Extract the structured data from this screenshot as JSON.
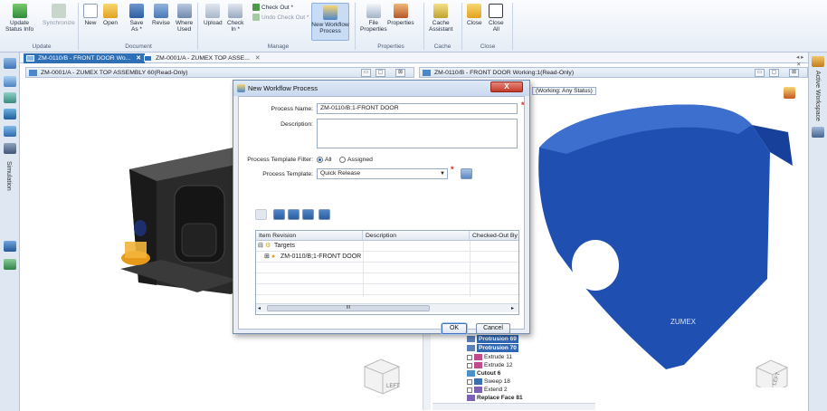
{
  "ribbon": {
    "update_status_info": "Update\nStatus Info",
    "synchronize": "Synchronize",
    "new": "New",
    "open": "Open",
    "save_as": "Save\nAs *",
    "revise": "Revise",
    "where_used": "Where\nUsed",
    "upload": "Upload",
    "check_in": "Check\nIn *",
    "check_out": "Check Out *",
    "undo_check_out": "Undo Check Out *",
    "new_workflow_process": "New Workflow\nProcess",
    "file_properties": "File\nProperties",
    "properties": "Properties",
    "cache_assistant": "Cache\nAssistant",
    "close": "Close",
    "close_all": "Close\nAll",
    "groups": {
      "update": "Update",
      "document": "Document",
      "manage": "Manage",
      "properties": "Properties",
      "cache": "Cache",
      "close": "Close"
    }
  },
  "tabs": [
    {
      "label": "ZM-0110/B - FRONT DOOR Wo..."
    },
    {
      "label": "ZM-0001/A - ZUMEX TOP ASSE..."
    }
  ],
  "left_pane_title": "ZM-0001/A - ZUMEX TOP ASSEMBLY 60(Read-Only)",
  "right_pane_title": "ZM-0110/B - FRONT DOOR Working:1(Read-Only)",
  "right_pane_subtitle": "(Working: Any Status)",
  "left_toolbar": {
    "simulation": "Simulation"
  },
  "right_toolbar": {
    "active_workspace": "Active Workspace"
  },
  "dialog": {
    "title": "New Workflow Process",
    "close_label": "X",
    "process_name_label": "Process Name:",
    "process_name_value": "ZM-0110/B;1-FRONT DOOR",
    "description_label": "Description:",
    "description_value": "",
    "filter_label": "Process Template Filter:",
    "filter_all": "All",
    "filter_assigned": "Assigned",
    "template_label": "Process Template:",
    "template_value": "Quick Release",
    "grid": {
      "columns": [
        "Item Revision",
        "Description",
        "Checked-Out By"
      ],
      "rows": [
        {
          "label": "Targets",
          "description": "",
          "checked_out_by": ""
        },
        {
          "label": "ZM-0110/B;1-FRONT DOOR",
          "description": "",
          "checked_out_by": ""
        }
      ],
      "scroll_thumb": "III"
    },
    "ok_label": "OK",
    "cancel_label": "Cancel"
  },
  "tree": [
    {
      "label": "Protrusion 69",
      "highlighted": true
    },
    {
      "label": "Protrusion 70",
      "highlighted": true
    },
    {
      "label": "Extrude 11",
      "highlighted": false
    },
    {
      "label": "Extrude 12",
      "highlighted": false
    },
    {
      "label": "Cutout 6",
      "highlighted": false
    },
    {
      "label": "Sweep 18",
      "highlighted": false
    },
    {
      "label": "Extend 2",
      "highlighted": false
    },
    {
      "label": "Replace Face 81",
      "highlighted": false
    }
  ],
  "viewcube_left": "LEFT",
  "viewcube_right": "LEFT",
  "brand_logo": "ZUMEX",
  "colors": {
    "accent": "#2e6fb6",
    "part_blue": "#1f4fb0",
    "machine_dark": "#2b2b2b",
    "required": "#dd2222"
  }
}
